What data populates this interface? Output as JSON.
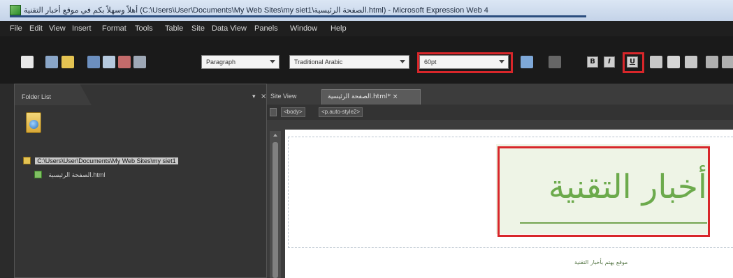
{
  "window": {
    "title": "أهلاً وسهلاً بكم في موقع أخبار التقنية (C:\\Users\\User\\Documents\\My Web Sites\\my siet1\\الصفحة الرئيسية.html) - Microsoft Expression Web 4"
  },
  "menu": {
    "items": [
      "File",
      "Edit",
      "View",
      "Insert",
      "Format",
      "Tools",
      "Table",
      "Site",
      "Data View",
      "Panels",
      "Window",
      "Help"
    ]
  },
  "toolbar": {
    "style_value": "Paragraph",
    "font_value": "Traditional Arabic",
    "size_value": "60pt",
    "bold_label": "B",
    "italic_label": "I",
    "underline_label": "U"
  },
  "folder_panel": {
    "title": "Folder List",
    "items": [
      {
        "label": "C:\\Users\\User\\Documents\\My Web Sites\\my siet1",
        "selected": true
      },
      {
        "label": "الصفحة الرئيسية.html",
        "selected": false
      }
    ]
  },
  "editor": {
    "site_view_label": "Site View",
    "doc_tab_label": "الصفحة الرئيسية.html* ×",
    "breadcrumbs": [
      "<body>",
      "<p.auto-style2>"
    ],
    "heading": "أخبار التقنية",
    "subtext": "موقع يهتم بأخبار التقنية"
  },
  "colors": {
    "highlight": "#d8262a",
    "heading_green": "#6caa4c",
    "panel_bg": "#343434"
  }
}
